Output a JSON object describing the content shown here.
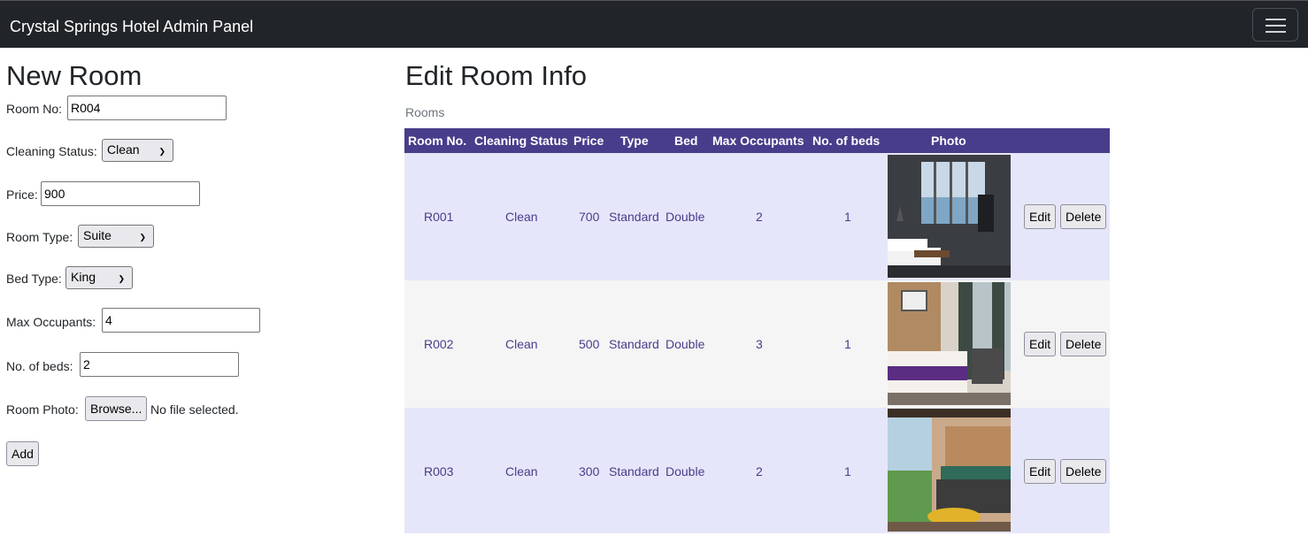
{
  "navbar": {
    "brand": "Crystal Springs Hotel Admin Panel"
  },
  "new_room": {
    "title": "New Room",
    "room_no_label": "Room No:",
    "room_no_value": "R004",
    "cleaning_label": "Cleaning Status:",
    "cleaning_value": "Clean",
    "price_label": "Price:",
    "price_value": "900",
    "type_label": "Room Type:",
    "type_value": "Suite",
    "bed_label": "Bed Type:",
    "bed_value": "King",
    "occupants_label": "Max Occupants:",
    "occupants_value": "4",
    "beds_label": "No. of beds:",
    "beds_value": "2",
    "photo_label": "Room Photo:",
    "browse_label": "Browse...",
    "no_file": "No file selected.",
    "add_label": "Add"
  },
  "edit": {
    "title": "Edit Room Info",
    "caption": "Rooms",
    "headers": [
      "Room No.",
      "Cleaning Status",
      "Price",
      "Type",
      "Bed",
      "Max Occupants",
      "No. of beds",
      "Photo"
    ],
    "edit_label": "Edit",
    "delete_label": "Delete",
    "rows": [
      {
        "room": "R001",
        "status": "Clean",
        "price": "700",
        "type": "Standard",
        "bed": "Double",
        "occupants": "2",
        "beds": "1"
      },
      {
        "room": "R002",
        "status": "Clean",
        "price": "500",
        "type": "Standard",
        "bed": "Double",
        "occupants": "3",
        "beds": "1"
      },
      {
        "room": "R003",
        "status": "Clean",
        "price": "300",
        "type": "Standard",
        "bed": "Double",
        "occupants": "2",
        "beds": "1"
      }
    ]
  },
  "colors": {
    "navbar": "#212529",
    "table_header": "#483d8b",
    "row_odd": "#e6e6fa",
    "row_even": "#f5f5f5",
    "cell_text": "#483d8b"
  }
}
